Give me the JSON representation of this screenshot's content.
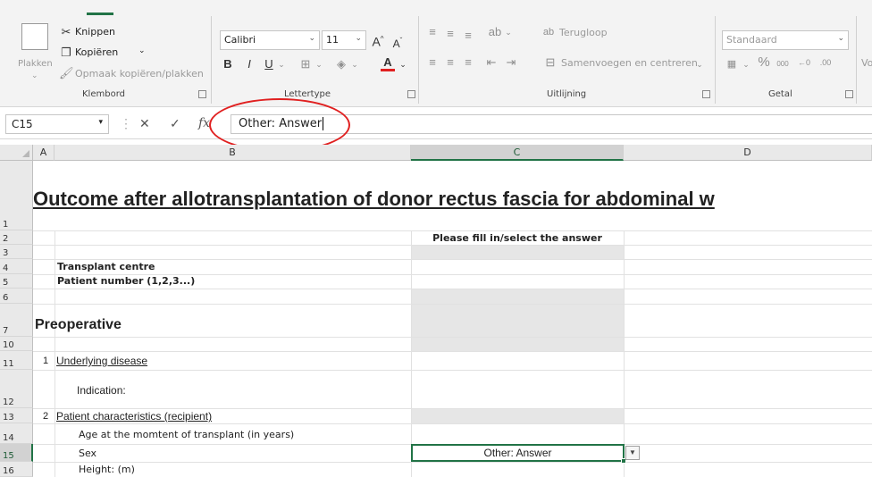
{
  "ribbon": {
    "klembord": {
      "paste_label": "Plakken",
      "cut_label": "Knippen",
      "copy_label": "Kopiëren",
      "format_painter_label": "Opmaak kopiëren/plakken",
      "group_label": "Klembord"
    },
    "lettertype": {
      "font_name": "Calibri",
      "font_size": "11",
      "group_label": "Lettertype",
      "font_color": "#e02020"
    },
    "uitlijning": {
      "wrap_label": "Terugloop",
      "merge_label": "Samenvoegen en centreren",
      "group_label": "Uitlijning"
    },
    "getal": {
      "number_format": "Standaard",
      "group_label": "Getal",
      "partial_label": "Vo"
    }
  },
  "formula_bar": {
    "cell_ref": "C15",
    "content": "Other: Answer"
  },
  "columns": [
    "A",
    "B",
    "C",
    "D"
  ],
  "selected_column": "C",
  "rows": [
    "1",
    "2",
    "3",
    "4",
    "5",
    "6",
    "7",
    "10",
    "11",
    "12",
    "13",
    "14",
    "15",
    "16"
  ],
  "selected_row": "15",
  "sheet": {
    "title": "Outcome after allotransplantation of donor rectus fascia for abdominal w",
    "c2_header": "Please fill in/select the answer",
    "transplant_centre": "Transplant centre",
    "patient_number": "Patient number (1,2,3...)",
    "preoperative": "Preoperative",
    "a11": "1",
    "underlying_disease": "Underlying disease",
    "indication": "Indication:",
    "a13": "2",
    "patient_characteristics": "Patient characteristics (recipient)",
    "age": "Age at the momtent of transplant (in years)",
    "sex": "Sex",
    "sex_value": "Other: Answer",
    "height": "Height: (m)"
  },
  "colors": {
    "accent": "#217346",
    "annotation": "#e02020"
  }
}
